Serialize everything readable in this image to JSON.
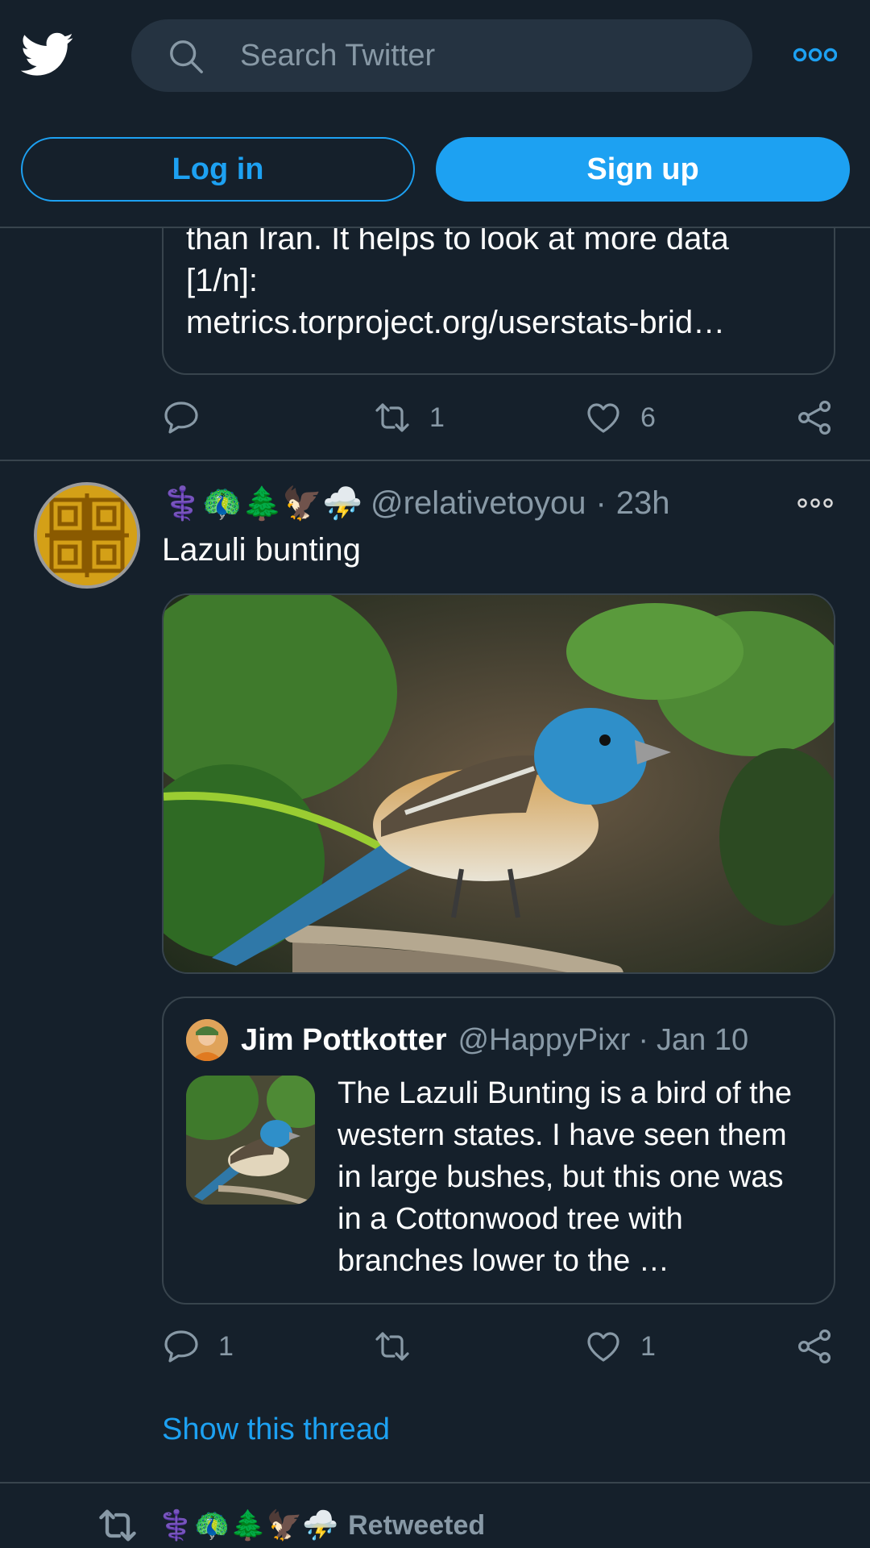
{
  "header": {
    "search_placeholder": "Search Twitter",
    "login_label": "Log in",
    "signup_label": "Sign up"
  },
  "prior_tweet": {
    "quote_tail_text": "than Iran. It helps to look at more data\n[1/n]:\nmetrics.torproject.org/userstats-brid…",
    "actions": {
      "reply": "",
      "retweet": "1",
      "like": "6"
    }
  },
  "tweet": {
    "emoji_name": "⚕️🦚🌲🦅⛈️",
    "handle": "@relativetoyou",
    "separator": "·",
    "time": "23h",
    "text": "Lazuli bunting",
    "quoted": {
      "name": "Jim Pottkotter",
      "handle": "@HappyPixr",
      "separator": "·",
      "time": "Jan 10",
      "text": "The Lazuli Bunting is a bird of the western states. I have seen them in large bushes, but this one was in a Cottonwood tree with branches lower to the …"
    },
    "actions": {
      "reply": "1",
      "retweet": "",
      "like": "1"
    },
    "show_thread": "Show this thread"
  },
  "next": {
    "emoji_name": "⚕️🦚🌲🦅⛈️",
    "retweeted_label": "Retweeted"
  },
  "colors": {
    "background": "#15202b",
    "accent": "#1da1f2",
    "muted": "#8899a6",
    "border": "#38444d"
  }
}
